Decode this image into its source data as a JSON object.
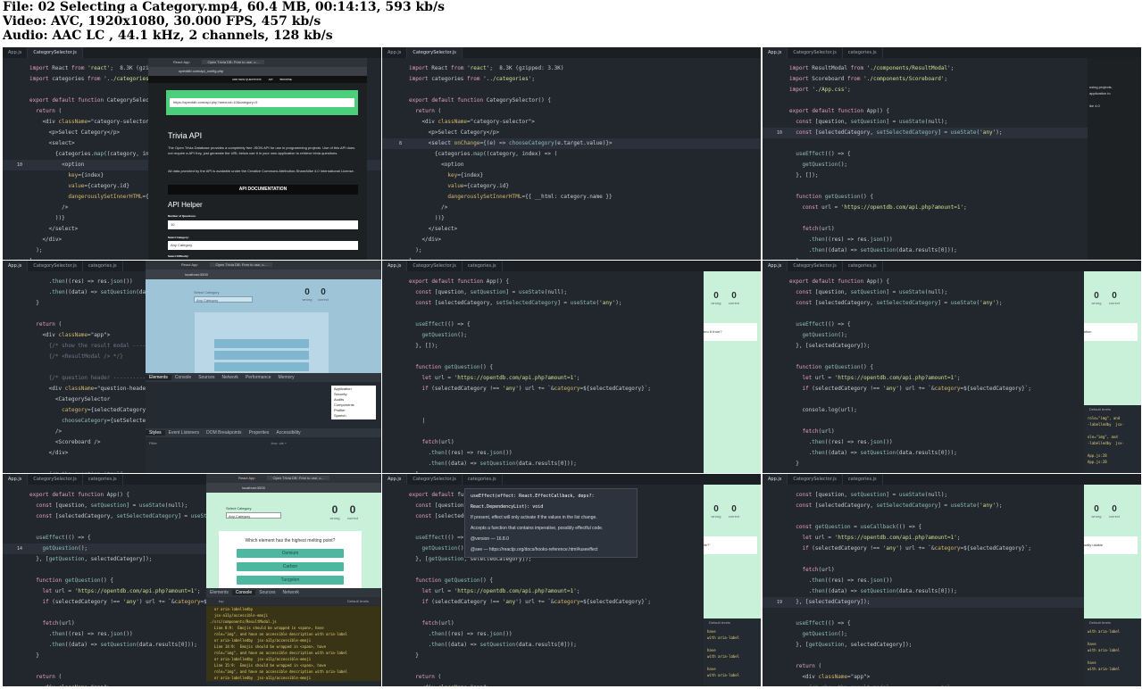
{
  "header": {
    "file_line": "File: 02 Selecting a Category.mp4, 60.4 MB, 00:14:13, 593 kb/s",
    "video_line": "Video: AVC, 1920x1080, 30.000 FPS, 457 kb/s",
    "audio_line": "Audio: AAC LC , 44.1 kHz, 2 channels, 128 kb/s"
  },
  "tiles": [
    {
      "tabs": [
        "App.js",
        "CategorySelector.js"
      ],
      "lines": [
        [
          "",
          "import React from 'react';  8.3K (gzipped: 3.3K)"
        ],
        [
          "",
          "import categories from '../categories';"
        ],
        [
          "",
          ""
        ],
        [
          "",
          "export default function CategorySelector() {"
        ],
        [
          "",
          "  return ("
        ],
        [
          "",
          "    <div className=\"category-selector\">"
        ],
        [
          "",
          "      <p>Select Category</p>"
        ],
        [
          "",
          "      <select>"
        ],
        [
          "",
          "        {categories.map((category, index) =>"
        ],
        [
          "10",
          "          <option"
        ],
        [
          "",
          "            key={index}"
        ],
        [
          "",
          "            value={category.id}"
        ],
        [
          "",
          "            dangerouslySetInnerHTML={{"
        ],
        [
          "",
          "          />"
        ],
        [
          "",
          "        ))}"
        ],
        [
          "",
          "      </select>"
        ],
        [
          "",
          "    </div>"
        ],
        [
          "",
          "  );"
        ],
        [
          "",
          "}"
        ]
      ],
      "browser": {
        "tab1": "React App",
        "tab2": "Open Trivia DB: Free to use, u...",
        "url": "opentdb.com/api_config.php",
        "nav": [
          "ADD NEW QUESTIONS",
          "API",
          "BROWSE"
        ],
        "api_url": "https://opentdb.com/api.php?amount=10&category=9",
        "section_title": "Trivia API",
        "para1": "The Open Trivia Database provides a completely free JSON API for use in programming projects. Use of this API does not require a API Key, just generate the URL below use it in your own application to retrieve trivia questions.",
        "para2": "All data provided by the API is available under the Creative Commons Attribution-ShareAlike 4.0 International License.",
        "doc_button": "API DOCUMENTATION",
        "helper_title": "API Helper",
        "field1_label": "Number of Questions:",
        "field1_value": "10",
        "field2_label": "Select Category:",
        "field2_value": "Any Category",
        "field3_label": "Select Difficulty:"
      }
    },
    {
      "tabs": [
        "App.js",
        "CategorySelector.js"
      ],
      "lines": [
        [
          "",
          "import React from 'react';  8.3K (gzipped: 3.3K)"
        ],
        [
          "",
          "import categories from '../categories';"
        ],
        [
          "",
          ""
        ],
        [
          "",
          "export default function CategorySelector() {"
        ],
        [
          "",
          "  return ("
        ],
        [
          "",
          "    <div className=\"category-selector\">"
        ],
        [
          "",
          "      <p>Select Category</p>"
        ],
        [
          "8",
          "      <select onChange={(e) => chooseCategory(e.target.value)}>"
        ],
        [
          "",
          "        {categories.map((category, index) => ("
        ],
        [
          "",
          "          <option"
        ],
        [
          "",
          "            key={index}"
        ],
        [
          "",
          "            value={category.id}"
        ],
        [
          "",
          "            dangerouslySetInnerHTML={{ __html: category.name }}"
        ],
        [
          "",
          "          />"
        ],
        [
          "",
          "        ))}"
        ],
        [
          "",
          "      </select>"
        ],
        [
          "",
          "    </div>"
        ],
        [
          "",
          "  );"
        ],
        [
          "",
          "}"
        ]
      ]
    },
    {
      "tabs": [
        "App.js",
        "CategorySelector.js",
        "categories.js"
      ],
      "lines": [
        [
          "",
          "import ResultModal from './components/ResultModal';"
        ],
        [
          "",
          "import Scoreboard from './components/Scoreboard';"
        ],
        [
          "",
          "import './App.css';"
        ],
        [
          "",
          ""
        ],
        [
          "",
          "export default function App() {"
        ],
        [
          "",
          "  const [question, setQuestion] = useState(null);"
        ],
        [
          "10",
          "  const [selectedCategory, setSelectedCategory] = useState('any');"
        ],
        [
          "",
          ""
        ],
        [
          "",
          "  useEffect(() => {"
        ],
        [
          "",
          "    getQuestion();"
        ],
        [
          "",
          "  }, []);"
        ],
        [
          "",
          ""
        ],
        [
          "",
          "  function getQuestion() {"
        ],
        [
          "",
          "    const url = 'https://opentdb.com/api.php?amount=1';"
        ],
        [
          "",
          ""
        ],
        [
          "",
          "    fetch(url)"
        ],
        [
          "",
          "      .then((res) => res.json())"
        ],
        [
          "",
          "      .then((data) => setQuestion(data.results[0]));"
        ],
        [
          "",
          "  }"
        ]
      ],
      "side_text": [
        "using projects.",
        "application to",
        "",
        "ike 4.0"
      ]
    },
    {
      "tabs": [
        "App.js",
        "CategorySelector.js",
        "categories.js"
      ],
      "lines": [
        [
          "",
          "      .then((res) => res.json())"
        ],
        [
          "",
          "      .then((data) => setQuestion(data.re"
        ],
        [
          "",
          "  }"
        ],
        [
          "",
          ""
        ],
        [
          "",
          "  return ("
        ],
        [
          "",
          "    <div className=\"app\">"
        ],
        [
          "",
          "      {/* show the result modal -------"
        ],
        [
          "",
          "      {/* <ResultModal /> */}"
        ],
        [
          "",
          ""
        ],
        [
          "",
          "      {/* question header ------------"
        ],
        [
          "",
          "      <div className=\"question-header\">"
        ],
        [
          "",
          "        <CategorySelector"
        ],
        [
          "",
          "          category={selectedCategory}"
        ],
        [
          "",
          "          chooseCategory={setSelectedCa"
        ],
        [
          "",
          "        />"
        ],
        [
          "",
          "        <Scoreboard />"
        ],
        [
          "",
          "      </div>"
        ],
        [
          "",
          ""
        ],
        [
          "",
          "      {/* the question itself ---------"
        ]
      ],
      "browser": {
        "tab1": "React App",
        "tab2": "Open Trivia DB: Free to use, u...",
        "url": "localhost:3000",
        "select_label": "Select Category",
        "select_value": "Any Category",
        "wrong": "0",
        "wrong_label": "wrong",
        "correct": "0",
        "correct_label": "correct",
        "dt_tabs": [
          "Elements",
          "Console",
          "Sources",
          "Network",
          "Performance",
          "Memory"
        ],
        "menu": [
          "Application",
          "Security",
          "Audits",
          "Components",
          "Profiler",
          "Speech"
        ],
        "dt_bottom": [
          "Styles",
          "Event Listeners",
          "DOM Breakpoints",
          "Properties",
          "Accessibility"
        ],
        "filter": "Filter",
        "hov": ":hov .cls +"
      }
    },
    {
      "tabs": [
        "App.js",
        "CategorySelector.js",
        "categories.js"
      ],
      "lines": [
        [
          "",
          "export default function App() {"
        ],
        [
          "",
          "  const [question, setQuestion] = useState(null);"
        ],
        [
          "",
          "  const [selectedCategory, setSelectedCategory] = useState('any');"
        ],
        [
          "",
          ""
        ],
        [
          "",
          "  useEffect(() => {"
        ],
        [
          "",
          "    getQuestion();"
        ],
        [
          "",
          "  }, []);"
        ],
        [
          "",
          ""
        ],
        [
          "",
          "  function getQuestion() {"
        ],
        [
          "",
          "    let url = 'https://opentdb.com/api.php?amount=1';"
        ],
        [
          "",
          "    if (selectedCategory !== 'any') url += `&category=${selectedCategory}`;"
        ],
        [
          "",
          ""
        ],
        [
          "",
          ""
        ],
        [
          "",
          "    |"
        ],
        [
          "",
          ""
        ],
        [
          "",
          "    fetch(url)"
        ],
        [
          "",
          "      .then((res) => res.json())"
        ],
        [
          "",
          "      .then((data) => setQuestion(data.results[0]));"
        ],
        [
          "",
          "  }"
        ]
      ],
      "side": {
        "wrong": "0",
        "correct": "0",
        "wrong_label": "wrong",
        "correct_label": "correct",
        "q": "ero 6 from?"
      }
    },
    {
      "tabs": [
        "App.js",
        "CategorySelector.js",
        "categories.js"
      ],
      "lines": [
        [
          "",
          "export default function App() {"
        ],
        [
          "",
          "  const [question, setQuestion] = useState(null);"
        ],
        [
          "",
          "  const [selectedCategory, setSelectedCategory] = useState('any');"
        ],
        [
          "",
          ""
        ],
        [
          "",
          "  useEffect(() => {"
        ],
        [
          "",
          "    getQuestion();"
        ],
        [
          "",
          "  }, [selectedCategory]);"
        ],
        [
          "",
          ""
        ],
        [
          "",
          "  function getQuestion() {"
        ],
        [
          "",
          "    let url = 'https://opentdb.com/api.php?amount=1';"
        ],
        [
          "",
          "    if (selectedCategory !== 'any') url += `&category=${selectedCategory}`;"
        ],
        [
          "",
          ""
        ],
        [
          "",
          "    console.log(url);"
        ],
        [
          "",
          ""
        ],
        [
          "",
          "    fetch(url)"
        ],
        [
          "",
          "      .then((res) => res.json())"
        ],
        [
          "",
          "      .then((data) => setQuestion(data.results[0]));"
        ],
        [
          "",
          "  }"
        ],
        [
          "",
          ""
        ]
      ],
      "side": {
        "wrong": "0",
        "correct": "0",
        "wrong_label": "wrong",
        "correct_label": "correct",
        "q": "stion",
        "levels": "Default levels",
        "console_lines": [
          "role=\"img\", and",
          "-labelledby  jsx-",
          "",
          "ole=\"img\", and",
          "-labelledby  jsx-",
          "",
          "App.js:28",
          "App.js:28"
        ]
      }
    },
    {
      "tabs": [
        "App.js",
        "CategorySelector.js",
        "categories.js"
      ],
      "lines": [
        [
          "",
          "export default function App() {"
        ],
        [
          "",
          "  const [question, setQuestion] = useState(null);"
        ],
        [
          "",
          "  const [selectedCategory, setSelectedCategory] = useState"
        ],
        [
          "",
          ""
        ],
        [
          "",
          "  useEffect(() => {"
        ],
        [
          "14",
          "    getQuestion();"
        ],
        [
          "",
          "  }, [getQuestion, selectedCategory]);"
        ],
        [
          "",
          ""
        ],
        [
          "",
          "  function getQuestion() {"
        ],
        [
          "",
          "    let url = 'https://opentdb.com/api.php?amount=1';"
        ],
        [
          "",
          "    if (selectedCategory !== 'any') url += `&category=${se"
        ],
        [
          "",
          ""
        ],
        [
          "",
          "    fetch(url)"
        ],
        [
          "",
          "      .then((res) => res.json())"
        ],
        [
          "",
          "      .then((data) => setQuestion(data.results[0]));"
        ],
        [
          "",
          "  }"
        ],
        [
          "",
          ""
        ],
        [
          "",
          "  return ("
        ],
        [
          "",
          "    <div className=\"app\">"
        ]
      ],
      "browser": {
        "tab1": "React App",
        "tab2": "Open Trivia DB: Free to use, u...",
        "url": "localhost:3000",
        "select_label": "Select Category",
        "select_value": "Any Category",
        "wrong": "0",
        "wrong_label": "wrong",
        "correct": "0",
        "correct_label": "correct",
        "question": "Which element has the highest melting point?",
        "answers": [
          "Osmium",
          "Carbon",
          "Tungsten"
        ],
        "dt_tabs": [
          "Elements",
          "Console",
          "Sources",
          "Network"
        ],
        "levels": "Default levels",
        "top": "top",
        "warnings": [
          "  or aria-labelledby",
          "  jsx-a11y/accessible-emoji",
          "./src/components/ResultModal.js",
          "  Line 8:9:  Emojis should be wrapped in <span>, have",
          "  role=\"img\", and have an accessible description with aria-label",
          "  or aria-labelledby  jsx-a11y/accessible-emoji",
          "  Line 14:9:  Emojis should be wrapped in <span>, have",
          "  role=\"img\", and have an accessible description with aria-label",
          "  or aria-labelledby  jsx-a11y/accessible-emoji",
          "  Line 15:9:  Emojis should be wrapped in <span>, have",
          "  role=\"img\", and have an accessible description with aria-label",
          "  or aria-labelledby  jsx-a11y/accessible-emoji"
        ]
      }
    },
    {
      "tabs": [
        "App.js",
        "CategorySelector.js",
        "categories.js"
      ],
      "lines": [
        [
          "",
          "export default func"
        ],
        [
          "",
          "  const [question,"
        ],
        [
          "",
          "  const [selectedCa"
        ],
        [
          "",
          ""
        ],
        [
          "",
          "  useEffect(() => {"
        ],
        [
          "",
          "    getQuestion();"
        ],
        [
          "",
          "  }, [getQuestion, selectedCategory]);"
        ],
        [
          "",
          ""
        ],
        [
          "",
          "  function getQuestion() {"
        ],
        [
          "",
          "    let url = 'https://opentdb.com/api.php?amount=1';"
        ],
        [
          "",
          "    if (selectedCategory !== 'any') url += `&category=${selectedCategory}`;"
        ],
        [
          "",
          ""
        ],
        [
          "",
          "    fetch(url)"
        ],
        [
          "",
          "      .then((res) => res.json())"
        ],
        [
          "",
          "      .then((data) => setQuestion(data.results[0]));"
        ],
        [
          "",
          "  }"
        ],
        [
          "",
          ""
        ],
        [
          "",
          "  return ("
        ],
        [
          "",
          "    <div className=\"app\">"
        ]
      ],
      "tooltip": [
        "useEffect(effect: React.EffectCallback, deps?:",
        "React.DependencyList): void",
        "If present, effect will only activate if the values in the list change.",
        "Accepts a function that contains imperative, possibly effectful code.",
        "@version — 16.8.0",
        "@see — https://reactjs.org/docs/hooks-reference.html#useeffect"
      ],
      "side": {
        "wrong": "0",
        "correct": "0",
        "wrong_label": "wrong",
        "correct_label": "correct",
        "q": "ile?\"",
        "levels": "Default levels",
        "console_lines": [
          "have",
          "with aria-label",
          "",
          "have",
          "with aria-label",
          "",
          "have",
          "with aria-label"
        ]
      }
    },
    {
      "tabs": [
        "App.js",
        "CategorySelector.js",
        "categories.js"
      ],
      "lines": [
        [
          "",
          "  const [question, setQuestion] = useState(null);"
        ],
        [
          "",
          "  const [selectedCategory, setSelectedCategory] = useState('any');"
        ],
        [
          "",
          ""
        ],
        [
          "",
          "  const getQuestion = useCallback(() => {"
        ],
        [
          "",
          "    let url = 'https://opentdb.com/api.php?amount=1';"
        ],
        [
          "",
          "    if (selectedCategory !== 'any') url += `&category=${selectedCategory}`;"
        ],
        [
          "",
          ""
        ],
        [
          "",
          "    fetch(url)"
        ],
        [
          "",
          "      .then((res) => res.json())"
        ],
        [
          "",
          "      .then((data) => setQuestion(data.results[0]));"
        ],
        [
          "19",
          "  }, [selectedCategory]);"
        ],
        [
          "",
          ""
        ],
        [
          "",
          "  useEffect(() => {"
        ],
        [
          "",
          "    getQuestion();"
        ],
        [
          "",
          "  }, [getQuestion, selectedCategory]);"
        ],
        [
          "",
          ""
        ],
        [
          "",
          "  return ("
        ],
        [
          "",
          "    <div className=\"app\">"
        ],
        [
          "",
          "      {/* show the result modal -------------- */}"
        ]
      ],
      "side": {
        "wrong": "0",
        "correct": "0",
        "wrong_label": "wrong",
        "correct_label": "correct",
        "q": "ually usable",
        "levels": "Default levels",
        "console_lines": [
          "with aria-label",
          "",
          "have",
          "with aria-label",
          "",
          "have",
          "with aria-label"
        ]
      }
    }
  ]
}
